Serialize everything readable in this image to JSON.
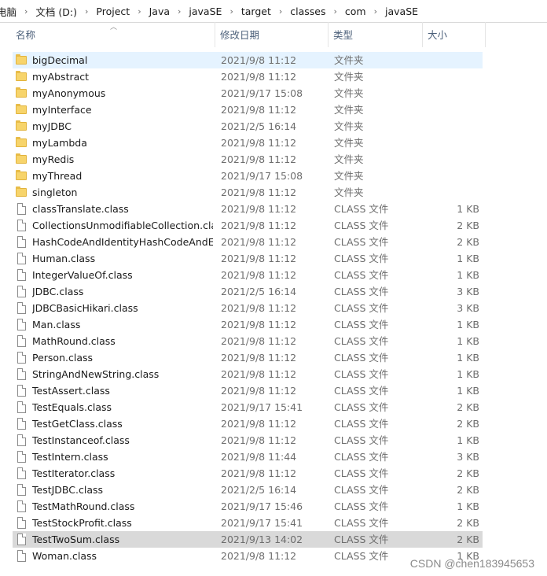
{
  "breadcrumb": [
    "电脑",
    "文档 (D:)",
    "Project",
    "Java",
    "javaSE",
    "target",
    "classes",
    "com",
    "javaSE"
  ],
  "columns": {
    "name": "名称",
    "date": "修改日期",
    "type": "类型",
    "size": "大小"
  },
  "files": [
    {
      "name": "bigDecimal",
      "date": "2021/9/8 11:12",
      "type": "文件夹",
      "size": "",
      "kind": "folder"
    },
    {
      "name": "myAbstract",
      "date": "2021/9/8 11:12",
      "type": "文件夹",
      "size": "",
      "kind": "folder"
    },
    {
      "name": "myAnonymous",
      "date": "2021/9/17 15:08",
      "type": "文件夹",
      "size": "",
      "kind": "folder"
    },
    {
      "name": "myInterface",
      "date": "2021/9/8 11:12",
      "type": "文件夹",
      "size": "",
      "kind": "folder"
    },
    {
      "name": "myJDBC",
      "date": "2021/2/5 16:14",
      "type": "文件夹",
      "size": "",
      "kind": "folder"
    },
    {
      "name": "myLambda",
      "date": "2021/9/8 11:12",
      "type": "文件夹",
      "size": "",
      "kind": "folder"
    },
    {
      "name": "myRedis",
      "date": "2021/9/8 11:12",
      "type": "文件夹",
      "size": "",
      "kind": "folder"
    },
    {
      "name": "myThread",
      "date": "2021/9/17 15:08",
      "type": "文件夹",
      "size": "",
      "kind": "folder"
    },
    {
      "name": "singleton",
      "date": "2021/9/8 11:12",
      "type": "文件夹",
      "size": "",
      "kind": "folder"
    },
    {
      "name": "classTranslate.class",
      "date": "2021/9/8 11:12",
      "type": "CLASS 文件",
      "size": "1 KB",
      "kind": "file"
    },
    {
      "name": "CollectionsUnmodifiableCollection.cla...",
      "date": "2021/9/8 11:12",
      "type": "CLASS 文件",
      "size": "2 KB",
      "kind": "file"
    },
    {
      "name": "HashCodeAndIdentityHashCodeAndE...",
      "date": "2021/9/8 11:12",
      "type": "CLASS 文件",
      "size": "2 KB",
      "kind": "file"
    },
    {
      "name": "Human.class",
      "date": "2021/9/8 11:12",
      "type": "CLASS 文件",
      "size": "1 KB",
      "kind": "file"
    },
    {
      "name": "IntegerValueOf.class",
      "date": "2021/9/8 11:12",
      "type": "CLASS 文件",
      "size": "1 KB",
      "kind": "file"
    },
    {
      "name": "JDBC.class",
      "date": "2021/2/5 16:14",
      "type": "CLASS 文件",
      "size": "3 KB",
      "kind": "file"
    },
    {
      "name": "JDBCBasicHikari.class",
      "date": "2021/9/8 11:12",
      "type": "CLASS 文件",
      "size": "3 KB",
      "kind": "file"
    },
    {
      "name": "Man.class",
      "date": "2021/9/8 11:12",
      "type": "CLASS 文件",
      "size": "1 KB",
      "kind": "file"
    },
    {
      "name": "MathRound.class",
      "date": "2021/9/8 11:12",
      "type": "CLASS 文件",
      "size": "1 KB",
      "kind": "file"
    },
    {
      "name": "Person.class",
      "date": "2021/9/8 11:12",
      "type": "CLASS 文件",
      "size": "1 KB",
      "kind": "file"
    },
    {
      "name": "StringAndNewString.class",
      "date": "2021/9/8 11:12",
      "type": "CLASS 文件",
      "size": "1 KB",
      "kind": "file"
    },
    {
      "name": "TestAssert.class",
      "date": "2021/9/8 11:12",
      "type": "CLASS 文件",
      "size": "1 KB",
      "kind": "file"
    },
    {
      "name": "TestEquals.class",
      "date": "2021/9/17 15:41",
      "type": "CLASS 文件",
      "size": "2 KB",
      "kind": "file"
    },
    {
      "name": "TestGetClass.class",
      "date": "2021/9/8 11:12",
      "type": "CLASS 文件",
      "size": "2 KB",
      "kind": "file"
    },
    {
      "name": "TestInstanceof.class",
      "date": "2021/9/8 11:12",
      "type": "CLASS 文件",
      "size": "1 KB",
      "kind": "file"
    },
    {
      "name": "TestIntern.class",
      "date": "2021/9/8 11:44",
      "type": "CLASS 文件",
      "size": "3 KB",
      "kind": "file"
    },
    {
      "name": "TestIterator.class",
      "date": "2021/9/8 11:12",
      "type": "CLASS 文件",
      "size": "2 KB",
      "kind": "file"
    },
    {
      "name": "TestJDBC.class",
      "date": "2021/2/5 16:14",
      "type": "CLASS 文件",
      "size": "2 KB",
      "kind": "file"
    },
    {
      "name": "TestMathRound.class",
      "date": "2021/9/17 15:46",
      "type": "CLASS 文件",
      "size": "1 KB",
      "kind": "file"
    },
    {
      "name": "TestStockProfit.class",
      "date": "2021/9/17 15:41",
      "type": "CLASS 文件",
      "size": "2 KB",
      "kind": "file"
    },
    {
      "name": "TestTwoSum.class",
      "date": "2021/9/13 14:02",
      "type": "CLASS 文件",
      "size": "2 KB",
      "kind": "file"
    },
    {
      "name": "Woman.class",
      "date": "2021/9/8 11:12",
      "type": "CLASS 文件",
      "size": "1 KB",
      "kind": "file"
    }
  ],
  "highlighted_file": "TestTwoSum.class",
  "hover_file": "bigDecimal",
  "watermark": "CSDN @chen183945653"
}
